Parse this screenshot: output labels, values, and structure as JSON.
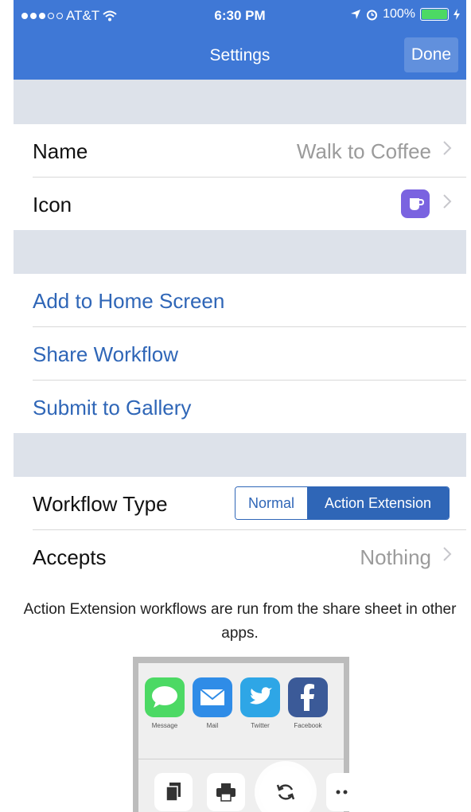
{
  "status_bar": {
    "carrier": "AT&T",
    "time": "6:30 PM",
    "battery": "100%"
  },
  "nav": {
    "title": "Settings",
    "done_label": "Done"
  },
  "section1": {
    "name_label": "Name",
    "name_value": "Walk to Coffee",
    "icon_label": "Icon",
    "icon_color": "#7a63e0"
  },
  "section2": {
    "items": [
      "Add to Home Screen",
      "Share Workflow",
      "Submit to Gallery"
    ]
  },
  "section3": {
    "workflow_type_label": "Workflow Type",
    "segment_options": [
      "Normal",
      "Action Extension"
    ],
    "segment_selected": "Action Extension",
    "accepts_label": "Accepts",
    "accepts_value": "Nothing"
  },
  "note": "Action Extension workflows are run from the share sheet in other apps.",
  "share_preview": {
    "apps": [
      "Message",
      "Mail",
      "Twitter",
      "Facebook"
    ]
  },
  "colors": {
    "accent": "#2f66b7",
    "nav_bar": "#3f78d6",
    "group_gap": "#dde2ea"
  }
}
